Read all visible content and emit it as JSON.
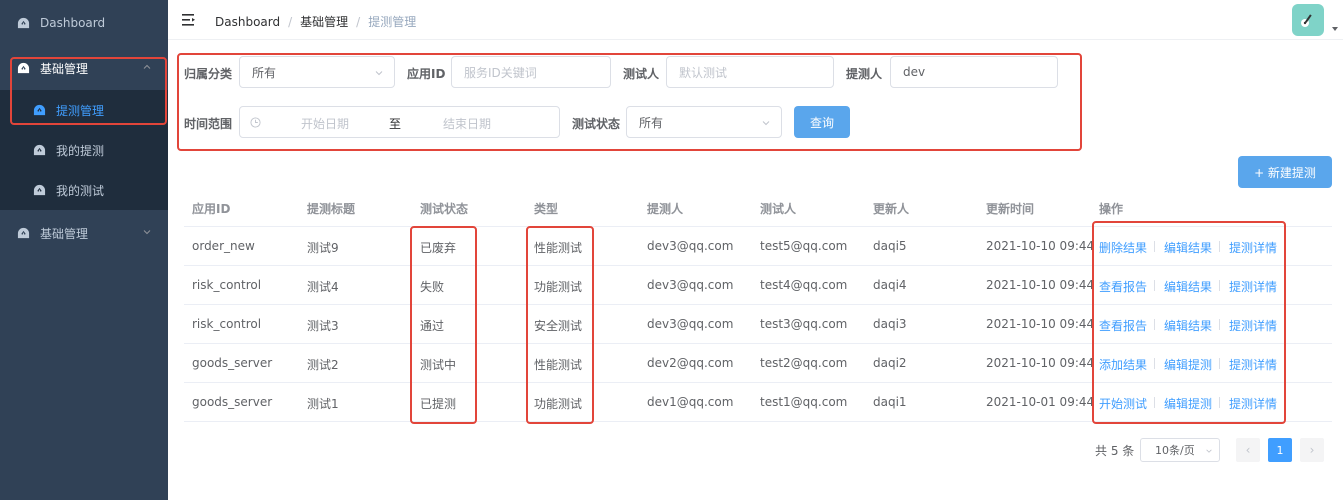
{
  "sidebar": {
    "dashboard": "Dashboard",
    "group1": "基础管理",
    "sub": [
      "提测管理",
      "我的提测",
      "我的测试"
    ],
    "group2": "基础管理"
  },
  "breadcrumb": [
    "Dashboard",
    "基础管理",
    "提测管理"
  ],
  "filters": {
    "category_label": "归属分类",
    "category_value": "所有",
    "app_label": "应用ID",
    "app_placeholder": "服务ID关键词",
    "tester_label": "测试人",
    "tester_placeholder": "默认测试",
    "submitter_label": "提测人",
    "submitter_value": "dev",
    "time_label": "时间范围",
    "start_placeholder": "开始日期",
    "range_sep": "至",
    "end_placeholder": "结束日期",
    "status_label": "测试状态",
    "status_value": "所有",
    "query_button": "查询"
  },
  "new_button": "+ 新建提测",
  "table": {
    "headers": [
      "应用ID",
      "提测标题",
      "测试状态",
      "类型",
      "提测人",
      "测试人",
      "更新人",
      "更新时间",
      "操作"
    ],
    "rows": [
      {
        "app": "order_new",
        "title": "测试9",
        "status": "已废弃",
        "type": "性能测试",
        "submitter": "dev3@qq.com",
        "tester": "test5@qq.com",
        "updater": "daqi5",
        "time": "2021-10-10 09:44",
        "ops": [
          "删除结果",
          "编辑结果",
          "提测详情"
        ]
      },
      {
        "app": "risk_control",
        "title": "测试4",
        "status": "失败",
        "type": "功能测试",
        "submitter": "dev3@qq.com",
        "tester": "test4@qq.com",
        "updater": "daqi4",
        "time": "2021-10-10 09:44",
        "ops": [
          "查看报告",
          "编辑结果",
          "提测详情"
        ]
      },
      {
        "app": "risk_control",
        "title": "测试3",
        "status": "通过",
        "type": "安全测试",
        "submitter": "dev3@qq.com",
        "tester": "test3@qq.com",
        "updater": "daqi3",
        "time": "2021-10-10 09:44",
        "ops": [
          "查看报告",
          "编辑结果",
          "提测详情"
        ]
      },
      {
        "app": "goods_server",
        "title": "测试2",
        "status": "测试中",
        "type": "性能测试",
        "submitter": "dev2@qq.com",
        "tester": "test2@qq.com",
        "updater": "daqi2",
        "time": "2021-10-10 09:44",
        "ops": [
          "添加结果",
          "编辑提测",
          "提测详情"
        ]
      },
      {
        "app": "goods_server",
        "title": "测试1",
        "status": "已提测",
        "type": "功能测试",
        "submitter": "dev1@qq.com",
        "tester": "test1@qq.com",
        "updater": "daqi1",
        "time": "2021-10-01 09:44",
        "ops": [
          "开始测试",
          "编辑提测",
          "提测详情"
        ]
      }
    ]
  },
  "pagination": {
    "total": "共 5 条",
    "page_size": "10条/页",
    "current": "1",
    "prev": "‹",
    "next": "›"
  },
  "colors": {
    "sidebar_bg": "#304156",
    "accent": "#409eff",
    "annotation_red": "#e2453a"
  }
}
